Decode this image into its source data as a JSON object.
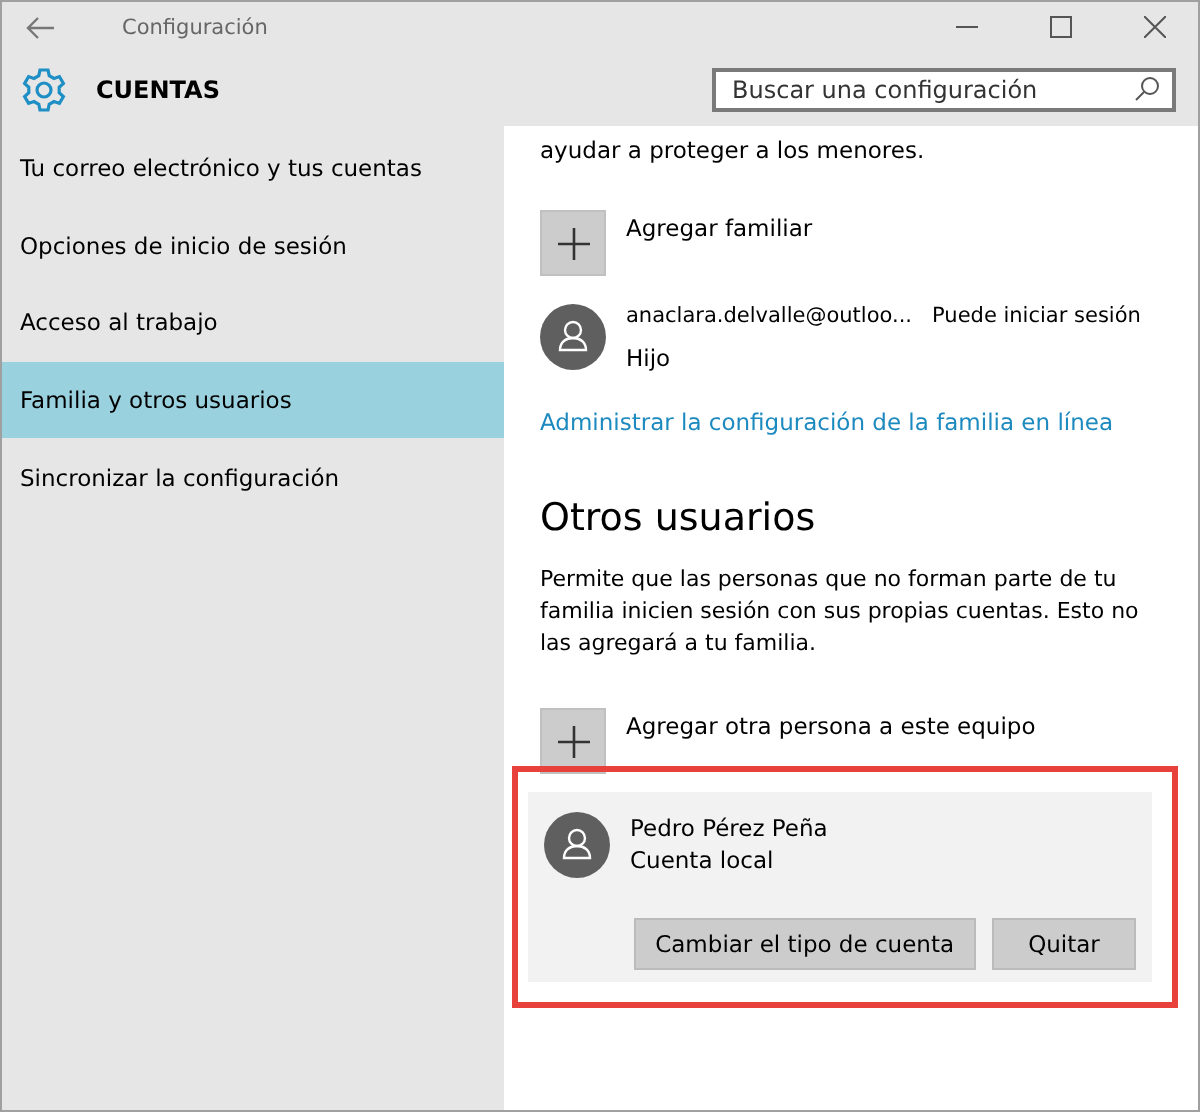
{
  "window": {
    "title": "Configuración"
  },
  "header": {
    "title": "CUENTAS"
  },
  "search": {
    "placeholder": "Buscar una configuración"
  },
  "sidebar": {
    "items": [
      {
        "label": "Tu correo electrónico y tus cuentas",
        "selected": false
      },
      {
        "label": "Opciones de inicio de sesión",
        "selected": false
      },
      {
        "label": "Acceso al trabajo",
        "selected": false
      },
      {
        "label": "Familia y otros usuarios",
        "selected": true
      },
      {
        "label": "Sincronizar la configuración",
        "selected": false
      }
    ]
  },
  "family": {
    "intro_tail": "ayudar a proteger a los menores.",
    "add_label": "Agregar familiar",
    "members": [
      {
        "name": "anaclara.delvalle@outloo...",
        "status": "Puede iniciar sesión",
        "role": "Hijo"
      }
    ],
    "link": "Administrar la configuración de la familia en línea"
  },
  "others": {
    "heading": "Otros usuarios",
    "description": "Permite que las personas que no forman parte de tu familia inicien sesión con sus propias cuentas. Esto no las agregará a tu familia.",
    "add_label": "Agregar otra persona a este equipo",
    "users": [
      {
        "name": "Pedro Pérez Peña",
        "type": "Cuenta local",
        "expanded": true,
        "highlighted": true,
        "buttons": [
          "Cambiar el tipo de cuenta",
          "Quitar"
        ]
      }
    ]
  }
}
